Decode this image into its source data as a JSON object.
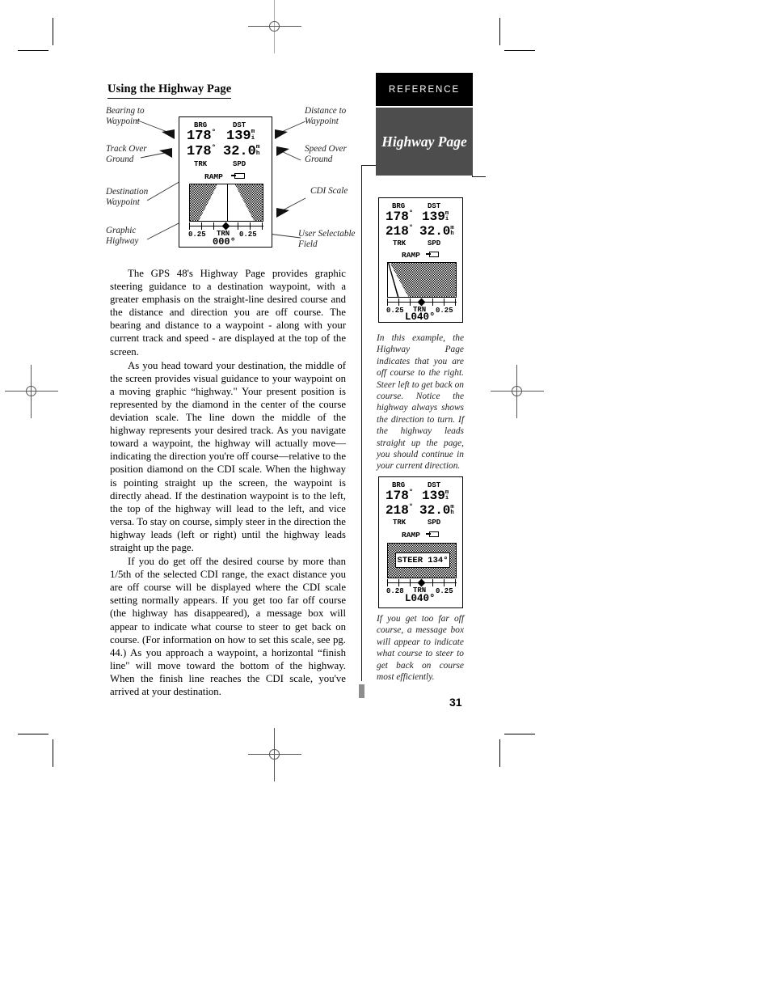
{
  "document": {
    "page_number": "31",
    "reference_bar": "REFERENCE",
    "chapter_tab": "Highway Page",
    "section_title": "Using the Highway Page"
  },
  "body": {
    "paragraphs": [
      "The GPS 48's Highway Page provides graphic steering guidance to a destination waypoint, with a greater emphasis on the straight-line desired course and the distance and direction you are off course.  The bearing and distance to a waypoint - along with your current track and speed - are displayed at the top of the screen.",
      "As you head toward your destination, the middle of the screen provides visual guidance to your waypoint on a moving graphic “highway.\"  Your present position is represented by the diamond in the center of the course deviation scale.  The line down the middle of the highway represents your desired track. As you navigate toward a waypoint, the highway will actually move—indicating the direction you're off course—relative to the position diamond on the CDI scale.  When the highway is pointing straight up the screen, the waypoint is directly ahead.  If the destination waypoint is to the left, the top of the highway will lead to the left, and vice versa.  To stay on course, simply steer in the direction the highway leads (left or right) until the highway leads straight up the page.",
      "If you do get off the desired course by more than 1/5th of the selected CDI range, the exact distance you are off course will be displayed where the CDI scale setting normally appears.  If you get too far off course (the highway has disappeared), a message box will appear to indicate what course to steer to get back on course.  (For information on how to set this scale, see pg. 44.)  As you approach a waypoint, a horizontal “finish line\" will move toward the bottom of the highway.  When the finish line reaches the CDI scale, you've arrived at your destination."
    ]
  },
  "diagram": {
    "callouts": {
      "bearing_to_waypoint": "Bearing to\nWaypoint",
      "track_over_ground": "Track Over\nGround",
      "destination_waypoint": "Destination\nWaypoint",
      "graphic_highway": "Graphic\nHighway",
      "distance_to_waypoint": "Distance to\nWaypoint",
      "speed_over_ground": "Speed Over\nGround",
      "cdi_scale": "CDI Scale",
      "user_selectable_field": "User Selectable\nField"
    }
  },
  "gps_screens": {
    "main": {
      "label_brg": "BRG",
      "label_dst": "DST",
      "value_brg": "178",
      "value_brg_unit": "°",
      "value_dst": "139",
      "value_dst_unit": "m",
      "value_trk": "178",
      "value_trk_unit": "°",
      "value_spd": "32.0",
      "value_spd_unit_top": "m",
      "value_spd_unit_bot": "h",
      "label_trk": "TRK",
      "label_spd": "SPD",
      "waypoint_name": "RAMP",
      "cdi_left": "0.25",
      "cdi_right": "0.25",
      "label_trn": "TRN",
      "value_trn": "000°",
      "highway_state": "centered"
    },
    "example_off_course": {
      "label_brg": "BRG",
      "label_dst": "DST",
      "value_brg": "178",
      "value_brg_unit": "°",
      "value_dst": "139",
      "value_dst_unit": "m",
      "value_trk": "218",
      "value_trk_unit": "°",
      "value_spd": "32.0",
      "value_spd_unit_top": "m",
      "value_spd_unit_bot": "h",
      "label_trk": "TRK",
      "label_spd": "SPD",
      "waypoint_name": "RAMP",
      "cdi_left": "0.25",
      "cdi_right": "0.25",
      "label_trn": "TRN",
      "value_trn": "L040°",
      "highway_state": "shifted-left"
    },
    "example_message_box": {
      "label_brg": "BRG",
      "label_dst": "DST",
      "value_brg": "178",
      "value_brg_unit": "°",
      "value_dst": "139",
      "value_dst_unit": "m",
      "value_trk": "218",
      "value_trk_unit": "°",
      "value_spd": "32.0",
      "value_spd_unit_top": "m",
      "value_spd_unit_bot": "h",
      "label_trk": "TRK",
      "label_spd": "SPD",
      "waypoint_name": "RAMP",
      "cdi_left": "0.28",
      "cdi_right": "0.25",
      "label_trn": "TRN",
      "value_trn": "L040°",
      "message": "STEER 134°",
      "highway_state": "message"
    }
  },
  "sidebar_captions": {
    "caption_1": "In this example, the Highway Page indicates that you are off course to the right. Steer left to get back on course. Notice the highway always shows the direction to turn. If the highway leads straight up the page, you should continue in your current direction.",
    "caption_2": "If you get too far off course, a message box will appear to indicate what course to steer to get back on course most efficiently."
  },
  "colors": {
    "reference_bar_bg": "#000000",
    "chapter_tab_bg": "#4d4d4d",
    "text": "#000000",
    "rule": "#1a1a1a",
    "end_mark": "#8d8d8d"
  }
}
